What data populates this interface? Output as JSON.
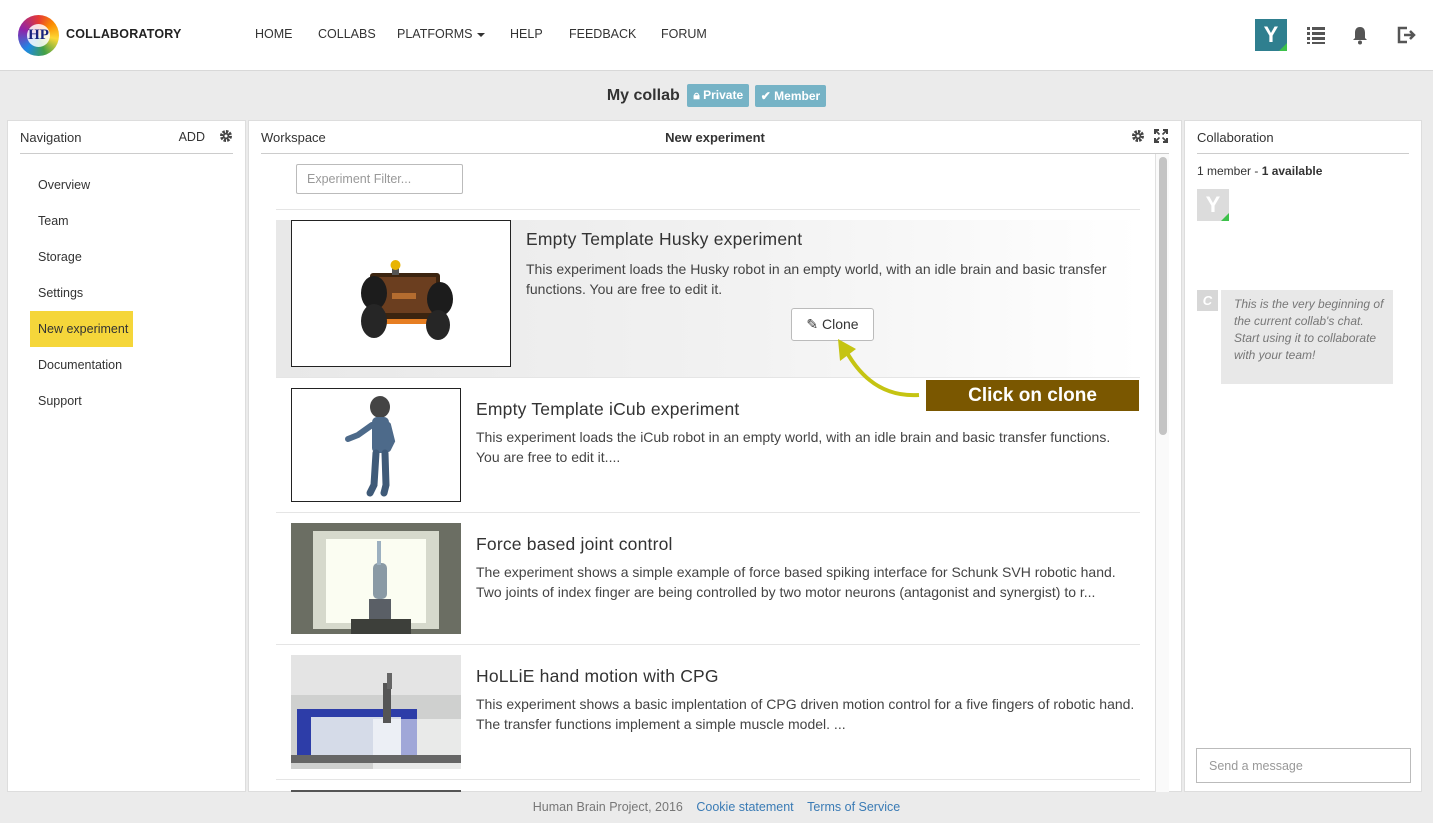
{
  "header": {
    "logo_text": "HP",
    "brand": "COLLABORATORY",
    "nav": [
      "HOME",
      "COLLABS",
      "PLATFORMS",
      "HELP",
      "FEEDBACK",
      "FORUM"
    ],
    "user_initial": "Y"
  },
  "collab": {
    "title": "My collab",
    "badges": [
      "Private",
      "Member"
    ]
  },
  "navigation": {
    "title": "Navigation",
    "add_label": "ADD",
    "items": [
      "Overview",
      "Team",
      "Storage",
      "Settings",
      "New experiment",
      "Documentation",
      "Support"
    ],
    "active": "New experiment"
  },
  "workspace": {
    "title": "Workspace",
    "page_title": "New experiment",
    "filter_placeholder": "Experiment Filter...",
    "experiments": [
      {
        "title": "Empty Template Husky experiment",
        "description": "This experiment loads the Husky robot in an empty world, with an idle brain and basic transfer functions. You are free to edit it."
      },
      {
        "title": "Empty Template iCub experiment",
        "description": "This experiment loads the iCub robot in an empty world, with an idle brain and basic transfer functions. You are free to edit it...."
      },
      {
        "title": "Force based joint control",
        "description": "The experiment shows a simple example of force based spiking interface for Schunk SVH robotic hand. Two joints of index finger are being controlled by two motor neurons (antagonist and synergist) to r..."
      },
      {
        "title": "HoLLiE hand motion with CPG",
        "description": "This experiment shows a basic implentation of CPG driven motion control for a five fingers of robotic hand. The transfer functions implement a simple muscle model. ..."
      }
    ],
    "clone_label": "Clone",
    "callout": "Click on clone"
  },
  "collaboration": {
    "title": "Collaboration",
    "member_count": "1 member -",
    "available": "1 available",
    "member_initial": "Y",
    "chat_initial": "C",
    "chat_message": "This is the very beginning of the current collab's chat. Start using it to collaborate with your team!",
    "send_placeholder": "Send a message"
  },
  "footer": {
    "copyright": "Human Brain Project, 2016",
    "links": [
      "Cookie statement",
      "Terms of Service"
    ]
  },
  "colors": {
    "active_nav": "#f5d63a",
    "badge": "#76b3c6",
    "callout": "#7a5700",
    "arrow": "#c5c412",
    "online": "#3cc14a",
    "link": "#3a7bb5"
  }
}
